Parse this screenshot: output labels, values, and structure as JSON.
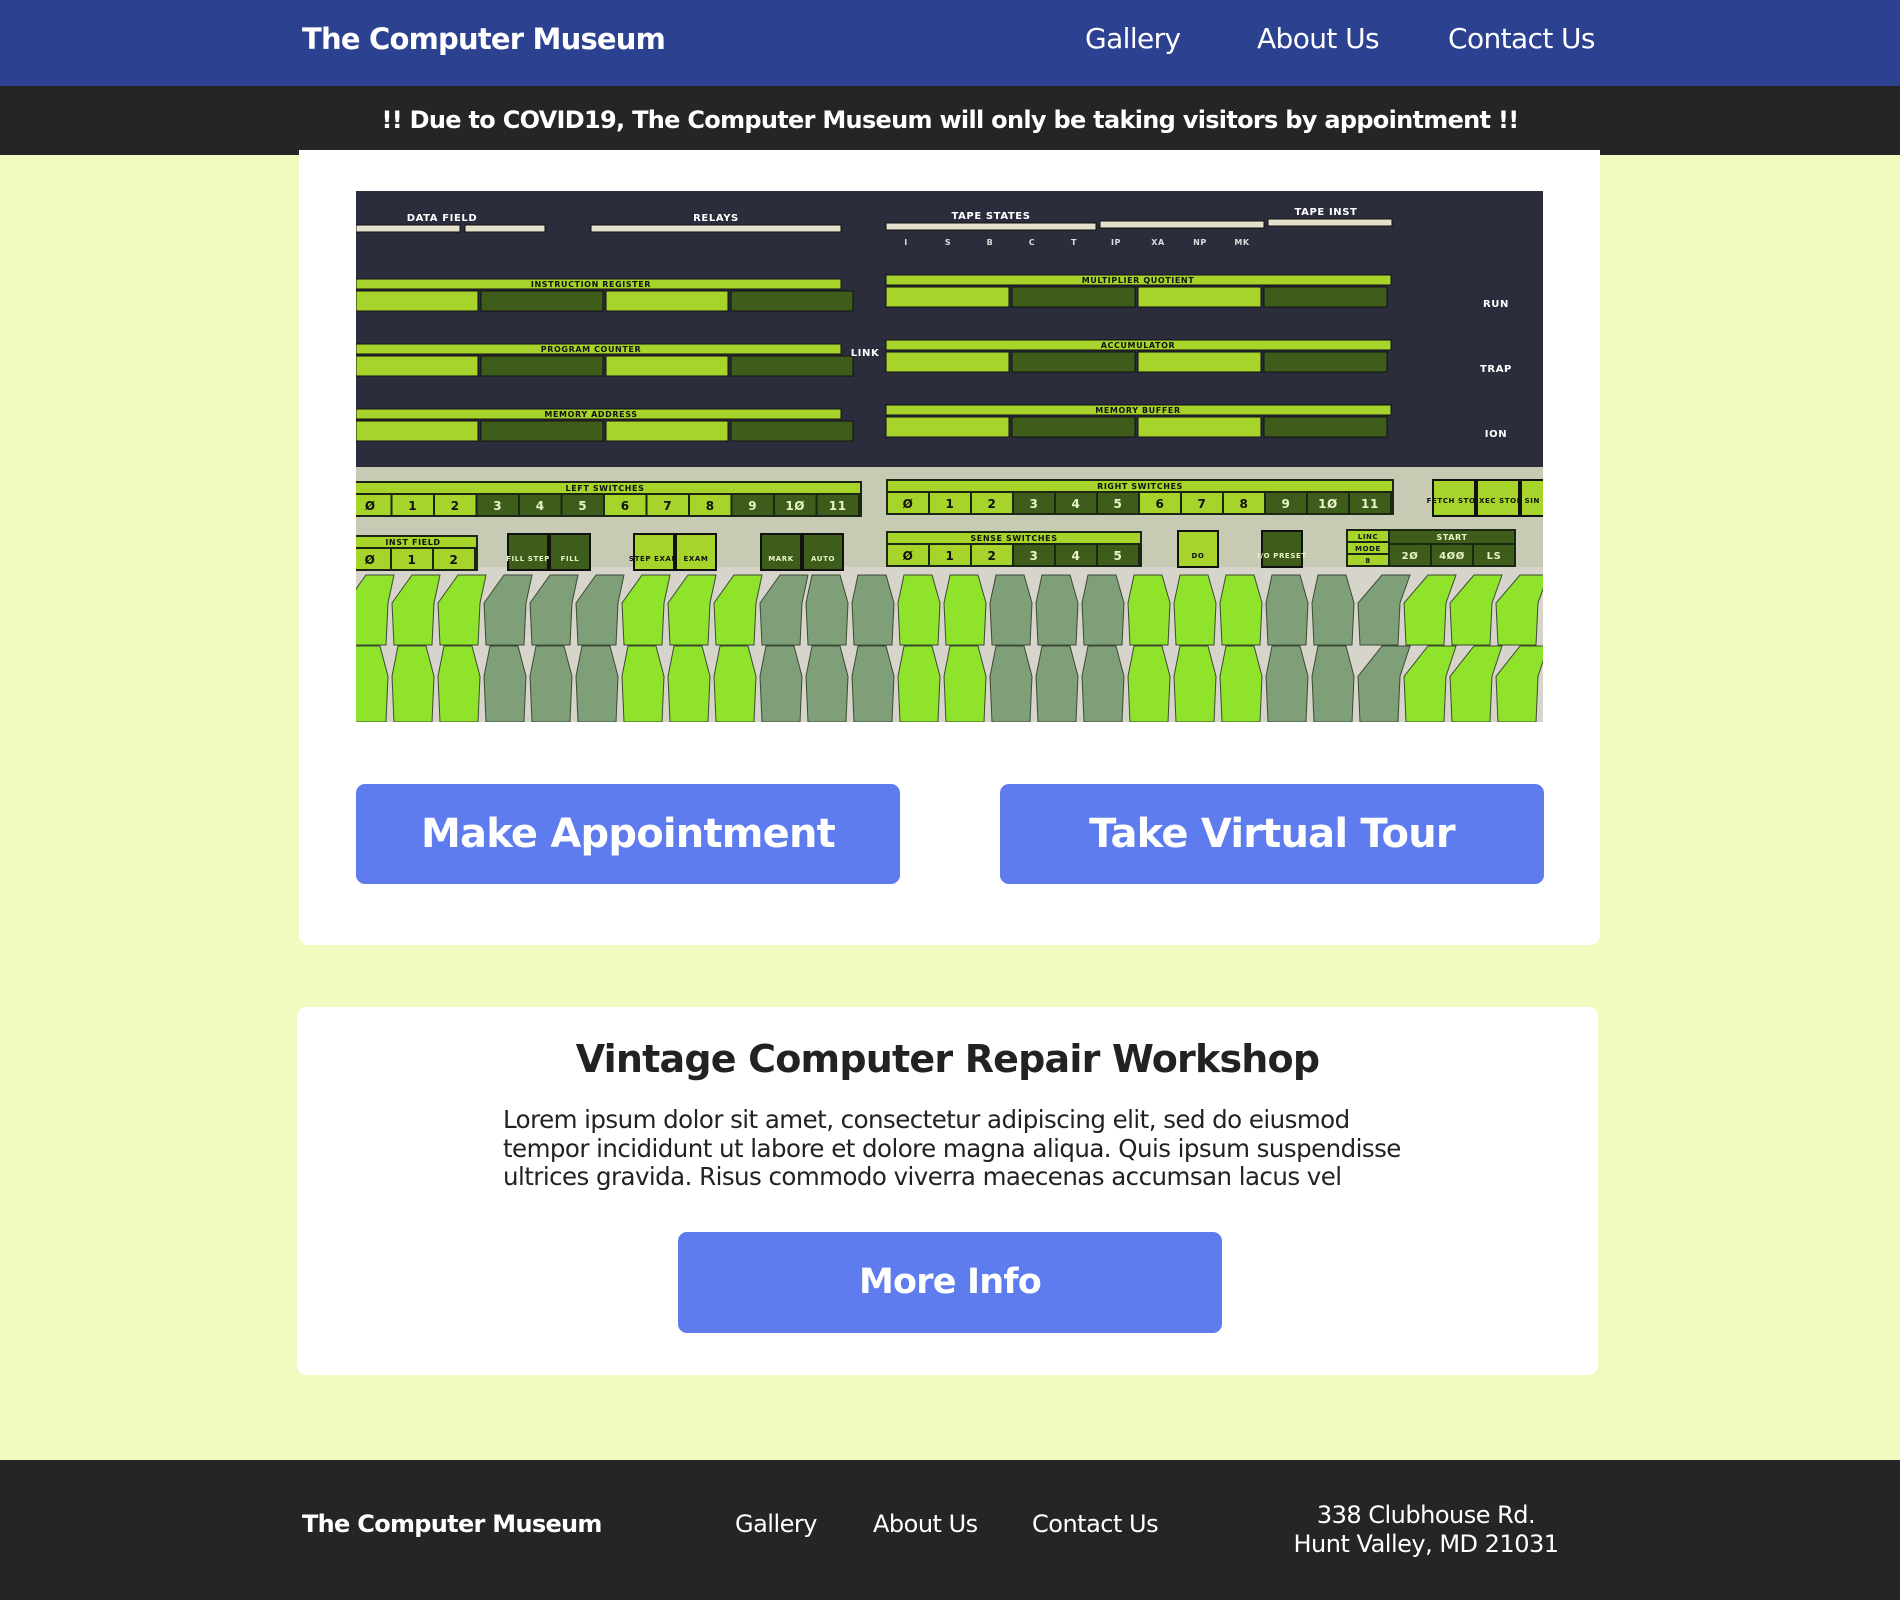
{
  "header": {
    "brand": "The Computer Museum",
    "nav": [
      "Gallery",
      "About Us",
      "Contact Us"
    ]
  },
  "banner": {
    "text": "!! Due to COVID19, The Computer Museum will only be taking visitors by appointment !!"
  },
  "hero": {
    "photo": {
      "description": "Front panel of a vintage computer with green indicator lamps and switches",
      "top_labels": [
        "DATA FIELD",
        "RELAYS",
        "TAPE STATES",
        "TAPE INST"
      ],
      "tape_state_letters": [
        "I",
        "S",
        "B",
        "C",
        "T",
        "IP",
        "XA",
        "NP",
        "MK"
      ],
      "left_registers": [
        "INSTRUCTION REGISTER",
        "PROGRAM COUNTER",
        "MEMORY ADDRESS"
      ],
      "right_registers": [
        "MULTIPLIER QUOTIENT",
        "ACCUMULATOR",
        "MEMORY BUFFER"
      ],
      "link_label": "LINK",
      "status_labels": [
        "RUN",
        "TRAP",
        "ION"
      ],
      "left_switches_label": "LEFT SWITCHES",
      "right_switches_label": "RIGHT SWITCHES",
      "switch_numbers": [
        "Ø",
        "1",
        "2",
        "3",
        "4",
        "5",
        "6",
        "7",
        "8",
        "9",
        "1Ø",
        "11"
      ],
      "inst_field_label": "INST FIELD",
      "inst_field_numbers": [
        "Ø",
        "1",
        "2"
      ],
      "sense_switches_label": "SENSE SWITCHES",
      "sense_numbers": [
        "Ø",
        "1",
        "2",
        "3",
        "4",
        "5"
      ],
      "control_keys": [
        "FILL STEP",
        "FILL",
        "STEP EXAM",
        "EXAM",
        "MARK",
        "AUTO",
        "DO",
        "I/O PRESET"
      ],
      "linc_labels": [
        "LINC",
        "MODE",
        "8"
      ],
      "start_label": "START",
      "start_keys": [
        "2Ø",
        "4ØØ",
        "LS"
      ],
      "stop_keys": [
        "FETCH STOP",
        "EXEC STOP",
        "SIN STE"
      ],
      "colors": {
        "panel": "#2b2d3c",
        "lamp_on": "#a6d42a",
        "lamp_off": "#3e5d1b",
        "silver": "#c8cbb4",
        "key_bright": "#8fe32a",
        "key_dull": "#7f9f78"
      }
    },
    "buttons": {
      "appointment": "Make Appointment",
      "tour": "Take Virtual Tour"
    }
  },
  "workshop": {
    "title": "Vintage Computer Repair Workshop",
    "body_lines": [
      "Lorem ipsum dolor sit amet, consectetur adipiscing elit, sed do eiusmod",
      "tempor incididunt ut labore et dolore magna aliqua. Quis ipsum suspendisse",
      "ultrices gravida. Risus commodo viverra maecenas accumsan lacus vel"
    ],
    "button": "More Info"
  },
  "footer": {
    "brand": "The Computer Museum",
    "nav": [
      "Gallery",
      "About Us",
      "Contact Us"
    ],
    "address_lines": [
      "338 Clubhouse Rd.",
      "Hunt Valley, MD 21031"
    ]
  },
  "theme": {
    "header_bg": "#2d4191",
    "banner_bg": "#252525",
    "page_bg": "#f2fbbf",
    "card_bg": "#ffffff",
    "button_bg": "#5e7cee",
    "footer_bg": "#252525"
  }
}
